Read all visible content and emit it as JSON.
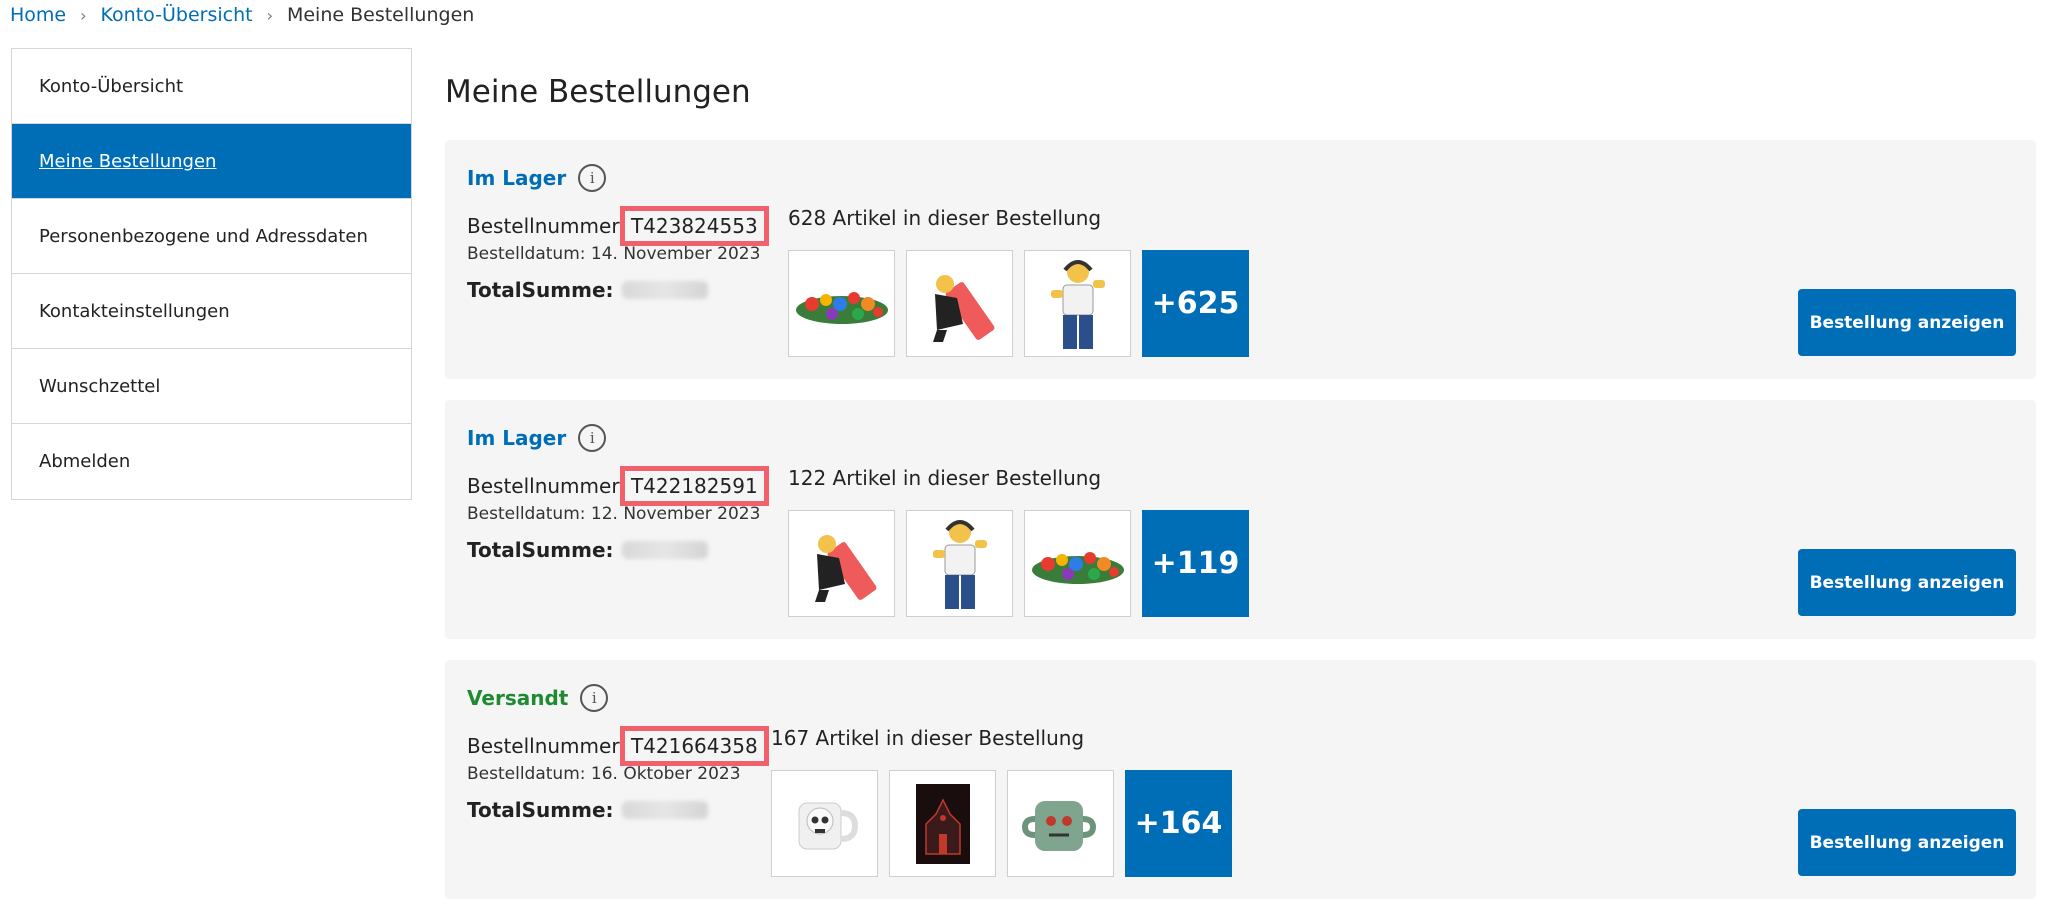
{
  "breadcrumb": {
    "home": "Home",
    "overview": "Konto-Übersicht",
    "current": "Meine Bestellungen"
  },
  "sidebar": {
    "items": [
      {
        "label": "Konto-Übersicht"
      },
      {
        "label": "Meine Bestellungen",
        "active": true
      },
      {
        "label": "Personenbezogene und Adressdaten"
      },
      {
        "label": "Kontakteinstellungen"
      },
      {
        "label": "Wunschzettel"
      },
      {
        "label": "Abmelden"
      }
    ]
  },
  "page_title": "Meine Bestellungen",
  "labels": {
    "order_no": "Bestellnummer:",
    "total": "TotalSumme:",
    "view_button": "Bestellung anzeigen",
    "info_icon": "i"
  },
  "orders": [
    {
      "status": "Im Lager",
      "order_number": "T423824553",
      "date": "Bestelldatum: 14. November 2023",
      "items_count": "628 Artikel in dieser Bestellung",
      "thumbnails": [
        "lego-pieces-pile",
        "lego-minifig-pushing-brick",
        "lego-minifig-headphones"
      ],
      "more": "+625"
    },
    {
      "status": "Im Lager",
      "order_number": "T422182591",
      "date": "Bestelldatum: 12. November 2023",
      "items_count": "122 Artikel in dieser Bestellung",
      "thumbnails": [
        "lego-minifig-pushing-brick",
        "lego-minifig-headphones",
        "lego-pieces-pile"
      ],
      "more": "+119"
    },
    {
      "status": "Versandt",
      "order_number": "T421664358",
      "date": "Bestelldatum: 16. Oktober 2023",
      "items_count": "167 Artikel in dieser Bestellung",
      "thumbnails": [
        "skull-mug-white",
        "haunted-house-poster",
        "zombie-mug-green"
      ],
      "more": "+164"
    }
  ],
  "colors": {
    "accent": "#006db7",
    "shipped": "#1f8a32",
    "highlight": "#f0616d",
    "card_bg": "#f5f5f5"
  }
}
